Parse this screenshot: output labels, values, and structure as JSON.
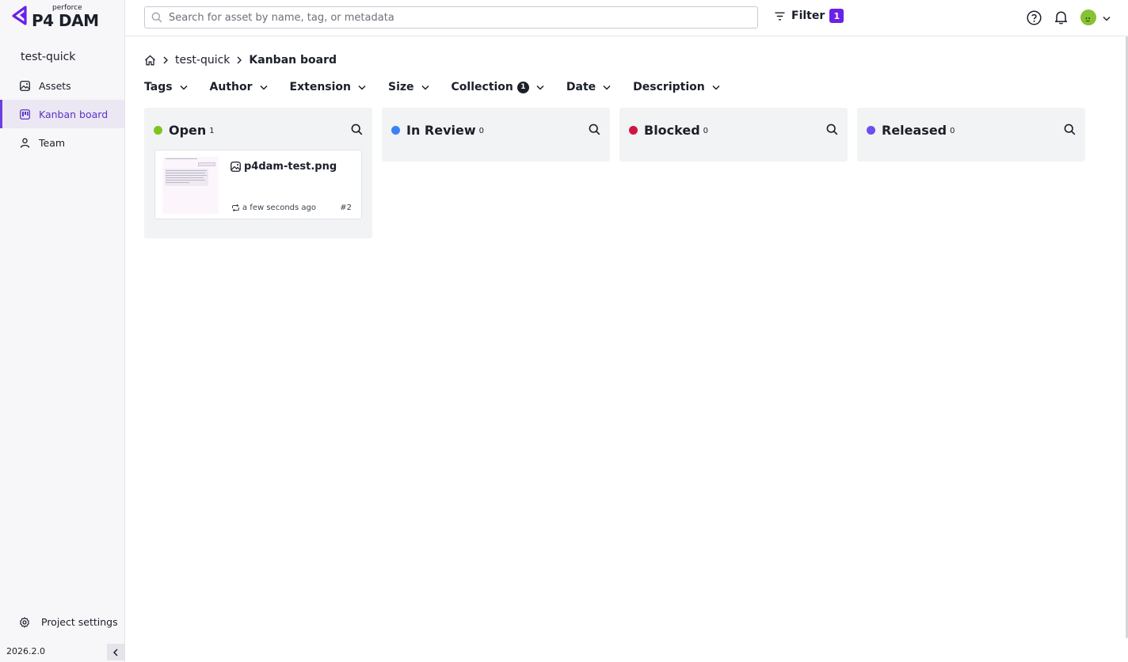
{
  "app": {
    "brand_small": "perforce",
    "brand_name": "P4 DAM",
    "version": "2026.2.0"
  },
  "sidebar": {
    "project_name": "test-quick",
    "items": [
      {
        "label": "Assets",
        "icon": "image-icon"
      },
      {
        "label": "Kanban board",
        "icon": "kanban-icon",
        "active": true
      },
      {
        "label": "Team",
        "icon": "person-icon"
      }
    ],
    "settings_label": "Project settings"
  },
  "search": {
    "placeholder": "Search for asset by name, tag, or metadata",
    "value": ""
  },
  "header": {
    "filter_label": "Filter",
    "filter_count": "1"
  },
  "breadcrumb": {
    "project": "test-quick",
    "current": "Kanban board"
  },
  "filters": [
    {
      "label": "Tags"
    },
    {
      "label": "Author"
    },
    {
      "label": "Extension"
    },
    {
      "label": "Size"
    },
    {
      "label": "Collection",
      "count": "1"
    },
    {
      "label": "Date"
    },
    {
      "label": "Description"
    }
  ],
  "columns": [
    {
      "title": "Open",
      "count": "1",
      "color": "#7cc61e"
    },
    {
      "title": "In Review",
      "count": "0",
      "color": "#3b82f6"
    },
    {
      "title": "Blocked",
      "count": "0",
      "color": "#d0163f"
    },
    {
      "title": "Released",
      "count": "0",
      "color": "#6d4ef0"
    }
  ],
  "card": {
    "filename": "p4dam-test.png",
    "updated": "a few seconds ago",
    "number": "#2"
  },
  "colors": {
    "accent": "#6b21e8",
    "sidebar_active_bg": "#ebe8f3"
  }
}
